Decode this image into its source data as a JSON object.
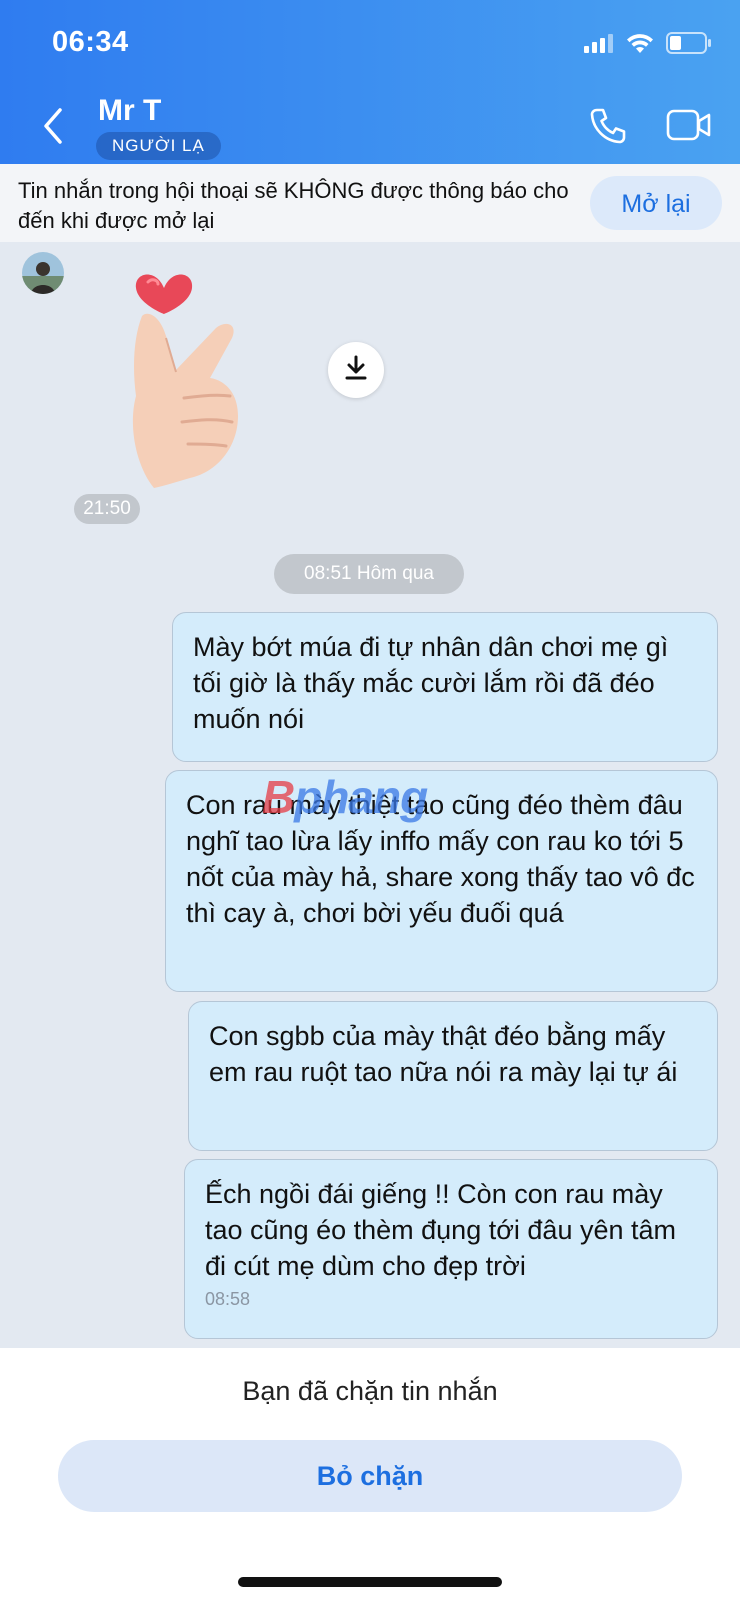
{
  "status_bar": {
    "time": "06:34"
  },
  "header": {
    "contact_name": "Mr T",
    "badge": "NGƯỜI LẠ"
  },
  "notice": {
    "text": "Tin nhắn trong hội thoại sẽ KHÔNG được thông báo cho đến khi được mở lại",
    "button": "Mở lại"
  },
  "sticker_time": "21:50",
  "date_separator": "08:51 Hôm qua",
  "messages": [
    {
      "text": "Mày bớt múa đi tự nhân dân chơi mẹ gì tối giờ là thấy mắc cười lắm rồi đã đéo muốn nói"
    },
    {
      "text": "Con rau mày thiệt tao cũng đéo thèm đâu nghĩ tao lừa lấy inffo mấy con rau ko tới 5 nốt của mày hả, share xong thấy tao vô đc thì cay à, chơi bời yếu đuối quá"
    },
    {
      "text": "Con sgbb của mày thật đéo bằng mấy em rau ruột tao nữa nói ra mày lại tự ái"
    },
    {
      "text": "Ếch ngồi đái giếng !! Còn con rau mày tao cũng éo thèm đụng tới đâu yên tâm đi cút mẹ dùm cho đẹp trời",
      "time": "08:58"
    }
  ],
  "watermark": {
    "part1": "B",
    "part2": "phang"
  },
  "footer": {
    "blocked_text": "Bạn đã chặn tin nhắn",
    "unblock_button": "Bỏ chặn"
  },
  "icons": [
    "signal-icon",
    "wifi-icon",
    "battery-icon",
    "back-icon",
    "phone-icon",
    "video-icon",
    "download-icon"
  ]
}
